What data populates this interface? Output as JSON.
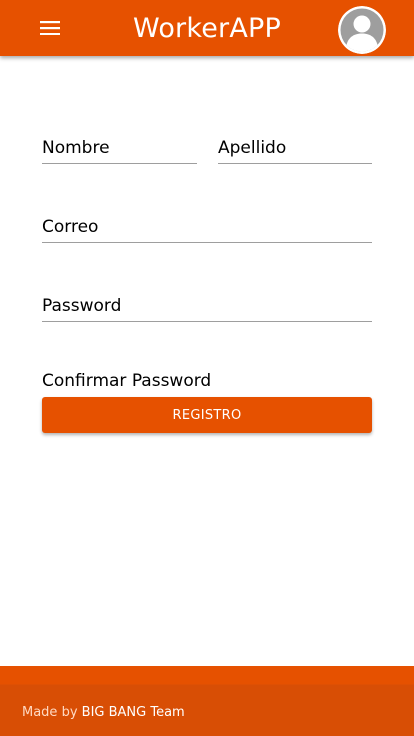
{
  "appbar": {
    "title": "WorkerAPP",
    "menu_icon": "hamburger-menu-icon",
    "avatar_icon": "user-avatar-icon"
  },
  "form": {
    "nombre_label": "Nombre",
    "apellido_label": "Apellido",
    "correo_label": "Correo",
    "password_label": "Password",
    "confirm_label": "Confirmar Password",
    "submit_label": "REGISTRO"
  },
  "footer": {
    "made_by": "Made by",
    "team": "BIG BANG Team"
  },
  "colors": {
    "primary": "#e65100",
    "footer_dark": "#d84e05",
    "underline": "#9e9e9e"
  }
}
